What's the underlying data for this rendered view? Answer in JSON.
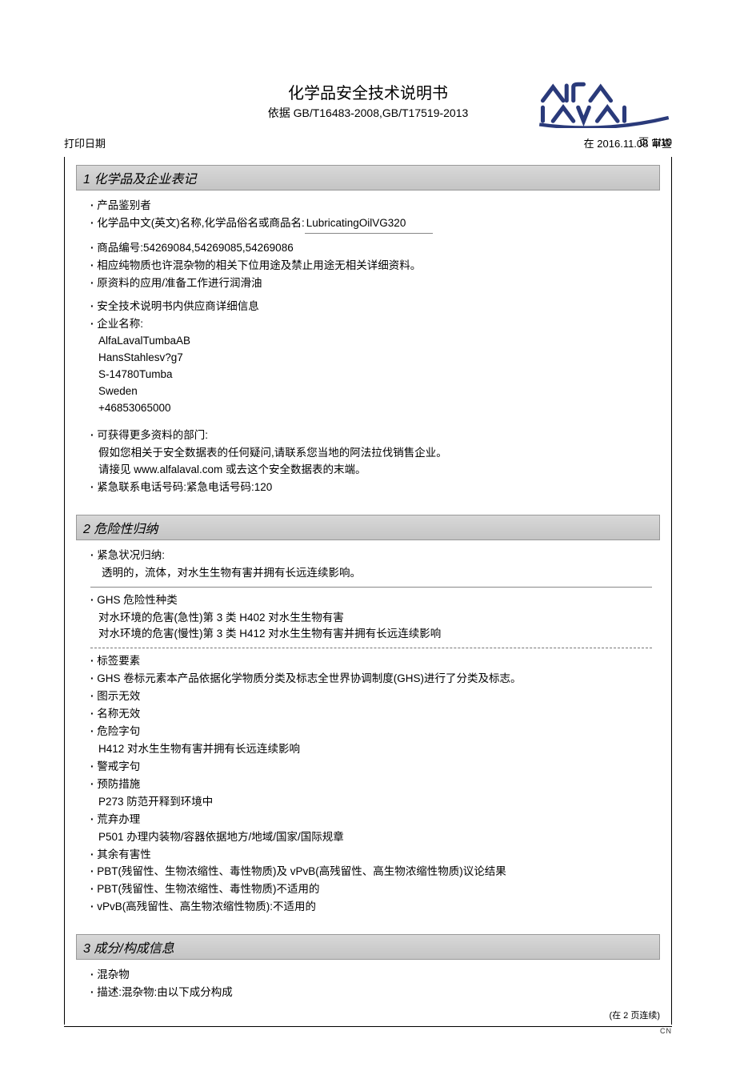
{
  "header": {
    "page_label": "页 1/10",
    "title": "化学品安全技术说明书",
    "subtitle": "依据 GB/T16483-2008,GB/T17519-2013",
    "print_label": "打印日期",
    "review_label": "在 2016.11.08 审查"
  },
  "section1": {
    "heading": "1 化学品及企业表记",
    "product_identifier_label": "产品鉴别者",
    "name_label_prefix": "化学品中文(英文)名称,化学品俗名或商品名:",
    "product_name": "LubricatingOilVG320",
    "article_no_label": "商品编号:",
    "article_no": "54269084,54269085,54269086",
    "use_line": "相应纯物质也许混杂物的相关下位用途及禁止用途无相关详细资料。",
    "material_line": "原资料的应用/准备工作进行润滑油",
    "supplier_heading": "安全技术说明书内供应商详细信息",
    "company_label": "企业名称:",
    "company_lines": [
      "AlfaLavalTumbaAB",
      "HansStahlesv?g7",
      "S-14780Tumba",
      "Sweden",
      "+46853065000"
    ],
    "dept_label": "可获得更多资料的部门:",
    "dept_line1": "假如您相关于安全数据表的任何疑问,请联系您当地的阿法拉伐销售企业。",
    "dept_line2": "请接见 www.alfalaval.com 或去这个安全数据表的末端。",
    "emergency_label": "紧急联系电话号码:",
    "emergency_value": "紧急电话号码:120"
  },
  "section2": {
    "heading": "2 危险性归纳",
    "emergency_overview_label": "紧急状况归纳:",
    "emergency_overview_text": "透明的，流体，对水生生物有害并拥有长远连续影响。",
    "ghs_class_label": "GHS 危险性种类",
    "ghs_line1": "对水环境的危害(急性)第 3 类 H402 对水生生物有害",
    "ghs_line2": "对水环境的危害(慢性)第 3 类 H412 对水生生物有害并拥有长远连续影响",
    "label_elements": "标签要素",
    "ghs_label_elements": "GHS 卷标元素本产品依据化学物质分类及标志全世界协调制度(GHS)进行了分类及标志。",
    "pictogram": "图示无效",
    "signal": "名称无效",
    "hazard_label": "危险字句",
    "h412": "H412 对水生生物有害并拥有长远连续影响",
    "precaution_label": "警戒字句",
    "prevention_label": "预防措施",
    "p273": "P273 防范开释到环境中",
    "disposal_label": "荒弃办理",
    "p501": "P501 办理内装物/容器依据地方/地域/国家/国际规章",
    "other_hazards": "其余有害性",
    "pbt_vpvb_results": "PBT(残留性、生物浓缩性、毒性物质)及 vPvB(高残留性、高生物浓缩性物质)议论结果",
    "pbt_na": "PBT(残留性、生物浓缩性、毒性物质)不适用的",
    "vpvb_na": "vPvB(高残留性、高生物浓缩性物质):不适用的"
  },
  "section3": {
    "heading": "3 成分/构成信息",
    "mixture_label": "混杂物",
    "description_label": "描述:",
    "description_text": "混杂物:由以下成分构成"
  },
  "footer": {
    "contd": "(在 2 页连续)",
    "cn": "CN"
  }
}
